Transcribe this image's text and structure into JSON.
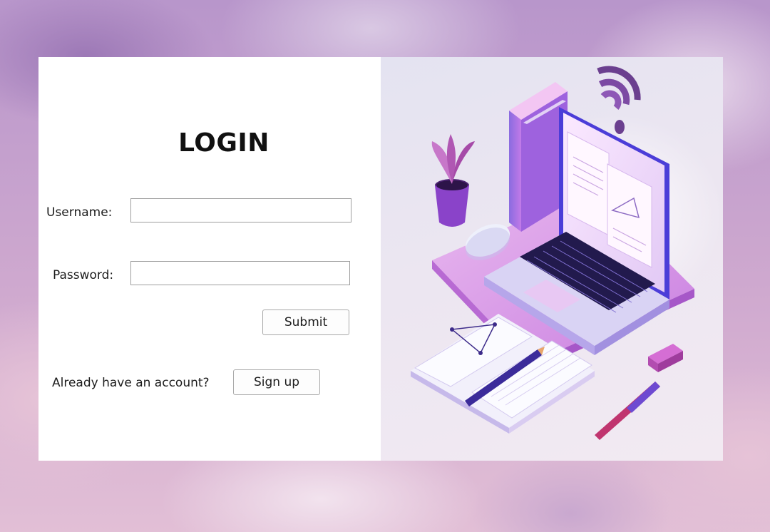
{
  "login": {
    "title": "LOGIN",
    "username_label": "Username:",
    "username_value": "",
    "password_label": "Password:",
    "password_value": "",
    "submit_label": "Submit",
    "account_prompt": "Already have an account?",
    "signup_label": "Sign up"
  },
  "colors": {
    "accent": "#8a4fd6",
    "illustration_bg": "#e8e5f1",
    "background": "#c4a3cf"
  },
  "illustration": {
    "icon": "workspace-laptop-illustration"
  }
}
